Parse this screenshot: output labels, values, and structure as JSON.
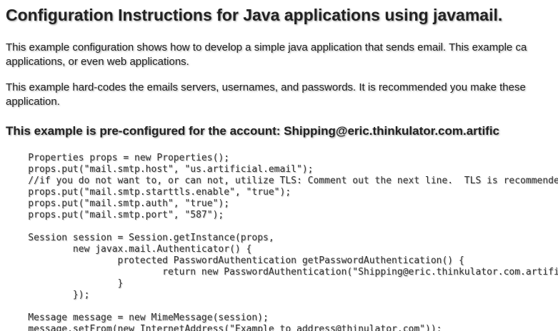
{
  "page": {
    "title": "Configuration Instructions for Java applications using javamail.",
    "paragraphs": [
      "This example configuration shows how to develop a simple java application that sends email. This example ca",
      "applications, or even web applications.",
      "This example hard-codes the emails servers, usernames, and passwords. It is recommended you make these",
      "application."
    ],
    "subtitle": "This example is pre-configured for the account: Shipping@eric.thinkulator.com.artific",
    "code_lines": [
      "    Properties props = new Properties();",
      "    props.put(\"mail.smtp.host\", \"us.artificial.email\");",
      "    //if you do not want to, or can not, utilize TLS: Comment out the next line.  TLS is recommende",
      "    props.put(\"mail.smtp.starttls.enable\", \"true\");",
      "    props.put(\"mail.smtp.auth\", \"true\");",
      "    props.put(\"mail.smtp.port\", \"587\");",
      "",
      "    Session session = Session.getInstance(props,",
      "            new javax.mail.Authenticator() {",
      "                    protected PasswordAuthentication getPasswordAuthentication() {",
      "                            return new PasswordAuthentication(\"Shipping@eric.thinkulator.com.artifi",
      "                    }",
      "            });",
      "",
      "    Message message = new MimeMessage(session);",
      "    message.setFrom(new InternetAddress(\"Example to address@thinulator.com\"));"
    ]
  }
}
